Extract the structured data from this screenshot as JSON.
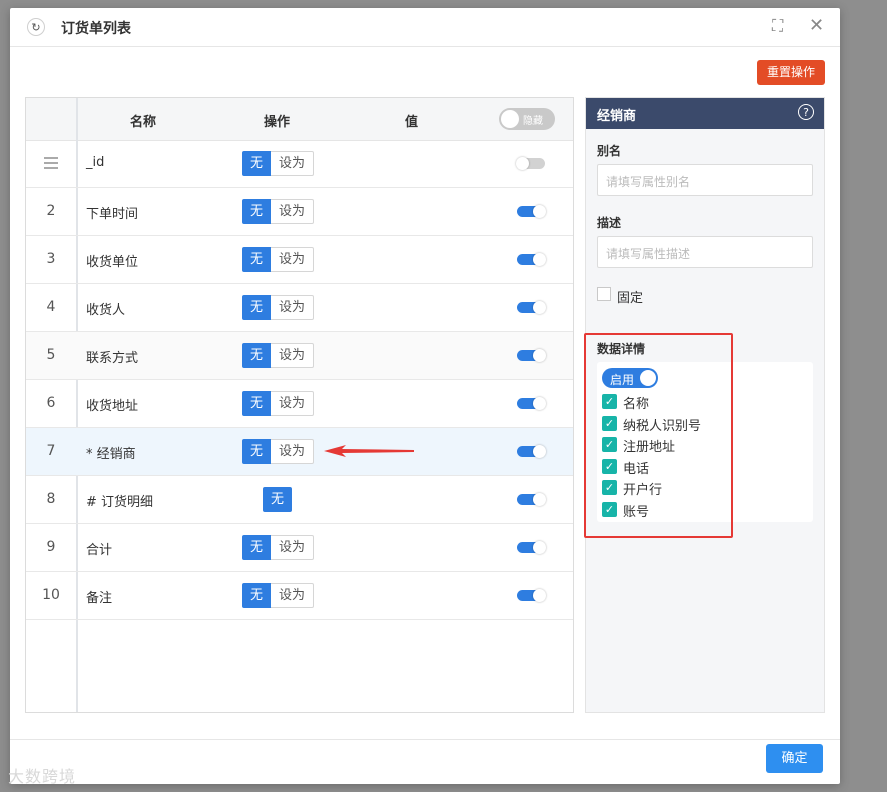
{
  "dialog": {
    "title": "订货单列表",
    "reset_label": "重置操作",
    "ok_label": "确定"
  },
  "grid": {
    "headers": {
      "name": "名称",
      "action": "操作",
      "value": "值"
    },
    "toggle_all_label": "隐藏",
    "none_label": "无",
    "setas_label": "设为",
    "rows": [
      {
        "index": "",
        "name": "_id"
      },
      {
        "index": "2",
        "name": "下单时间"
      },
      {
        "index": "3",
        "name": "收货单位"
      },
      {
        "index": "4",
        "name": "收货人"
      },
      {
        "index": "5",
        "name": "联系方式"
      },
      {
        "index": "6",
        "name": "收货地址"
      },
      {
        "index": "7",
        "name": "* 经销商"
      },
      {
        "index": "8",
        "name": "# 订货明细"
      },
      {
        "index": "9",
        "name": "合计"
      },
      {
        "index": "10",
        "name": "备注"
      }
    ]
  },
  "panel": {
    "title": "经销商",
    "alias_label": "别名",
    "alias_placeholder": "请填写属性别名",
    "desc_label": "描述",
    "desc_placeholder": "请填写属性描述",
    "fixed_label": "固定",
    "detail_title": "数据详情",
    "enable_label": "启用",
    "fields": [
      "名称",
      "纳税人识别号",
      "注册地址",
      "电话",
      "开户行",
      "账号"
    ]
  },
  "watermark": "大数跨境",
  "colors": {
    "accent": "#2e7de0",
    "danger": "#e34c26",
    "header": "#3b4a6b",
    "check": "#17b4a8"
  }
}
